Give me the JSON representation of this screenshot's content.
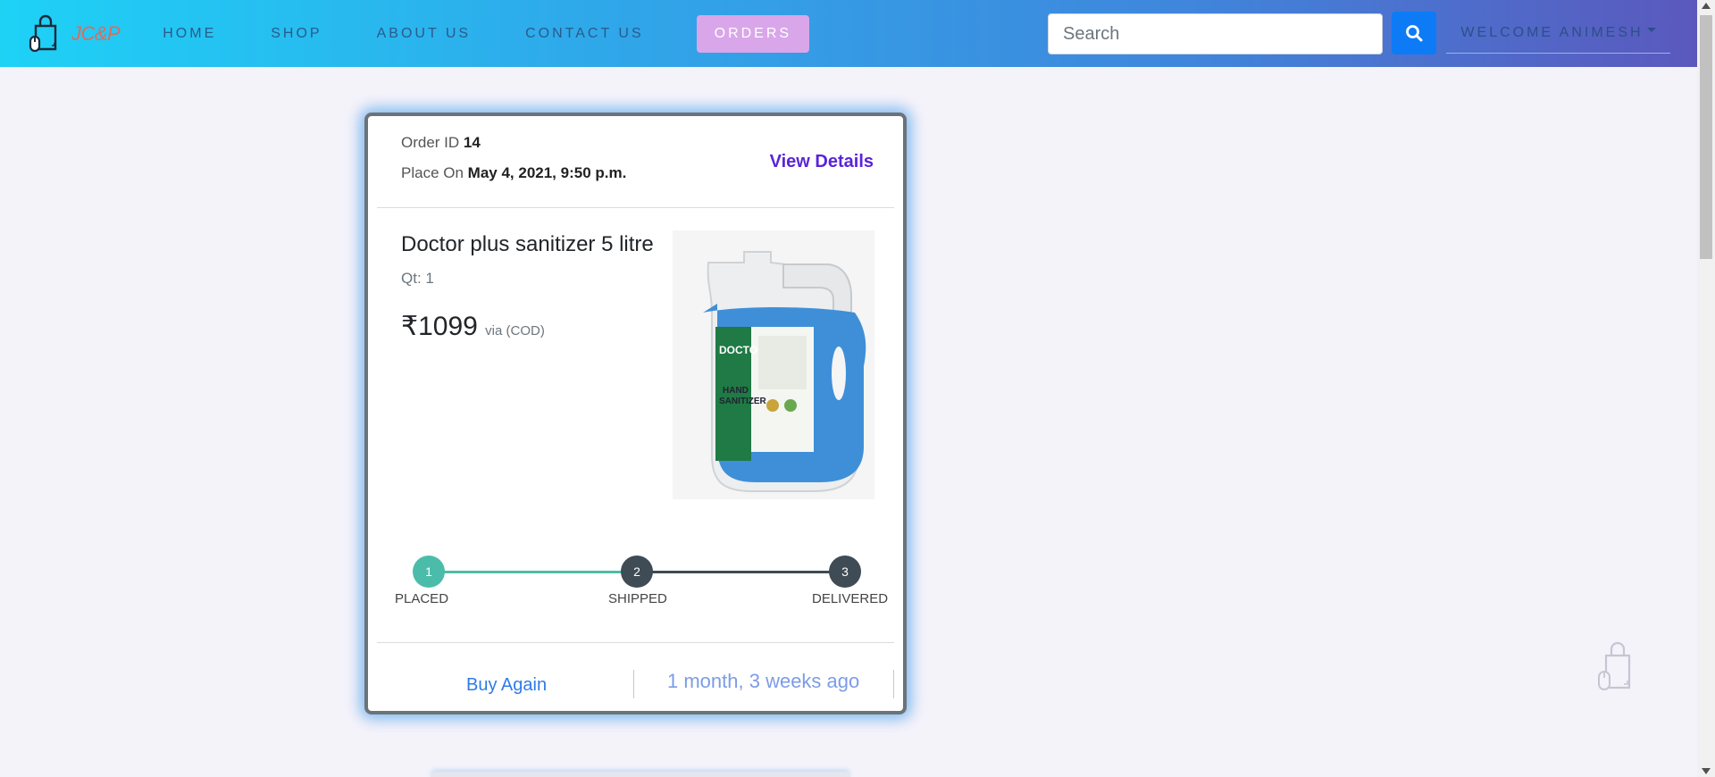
{
  "brand": {
    "name": "JC&P",
    "icon": "shopping-bag-mouse-icon"
  },
  "nav": {
    "home": "HOME",
    "shop": "SHOP",
    "about": "ABOUT US",
    "contact": "CONTACT US",
    "orders": "ORDERS"
  },
  "search": {
    "placeholder": "Search",
    "icon": "search-icon"
  },
  "user": {
    "welcome": "WELCOME ANIMESH"
  },
  "order": {
    "id_label": "Order ID",
    "id": "14",
    "placed_label": "Place On",
    "placed_on": "May 4, 2021, 9:50 p.m.",
    "view_details": "View Details",
    "product_name": "Doctor plus sanitizer 5 litre",
    "qty": "Qt: 1",
    "price": "₹1099",
    "payment": "via (COD)",
    "product_image": "hand-sanitizer-bottle-image",
    "steps": [
      {
        "number": "1",
        "label": "PLACED",
        "done": true
      },
      {
        "number": "2",
        "label": "SHIPPED",
        "done": false
      },
      {
        "number": "3",
        "label": "DELIVERED",
        "done": false
      }
    ],
    "buy_again": "Buy Again",
    "time_ago": "1 month, 3 weeks ago"
  },
  "colors": {
    "nav_gradient_start": "#1ed2f6",
    "nav_gradient_end": "#5b58bd",
    "orders_active_bg": "#d9a6ea",
    "search_button": "#0d7bf6",
    "step_done": "#4cbcaa",
    "step_pending": "#3f4b55",
    "view_details": "#5a24d9",
    "buy_again": "#2f7be6"
  }
}
